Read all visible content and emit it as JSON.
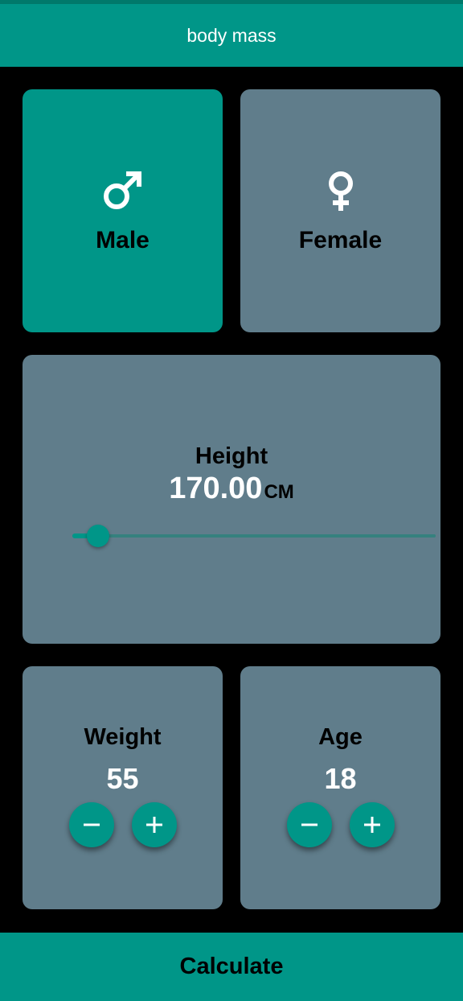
{
  "app_bar": {
    "title": "body mass"
  },
  "gender": {
    "selected": "male",
    "male": {
      "label": "Male",
      "icon": "male-symbol-icon"
    },
    "female": {
      "label": "Female",
      "icon": "female-symbol-icon"
    }
  },
  "height": {
    "title": "Height",
    "value": "170.00",
    "unit": "CM",
    "slider_fraction": 0.07
  },
  "weight": {
    "title": "Weight",
    "value": "55",
    "decrement_icon": "minus-icon",
    "increment_icon": "plus-icon"
  },
  "age": {
    "title": "Age",
    "value": "18",
    "decrement_icon": "minus-icon",
    "increment_icon": "plus-icon"
  },
  "calculate": {
    "label": "Calculate"
  },
  "colors": {
    "primary": "#009688",
    "card": "#607d8b",
    "background": "#000000",
    "status_strip": "#00796b"
  }
}
